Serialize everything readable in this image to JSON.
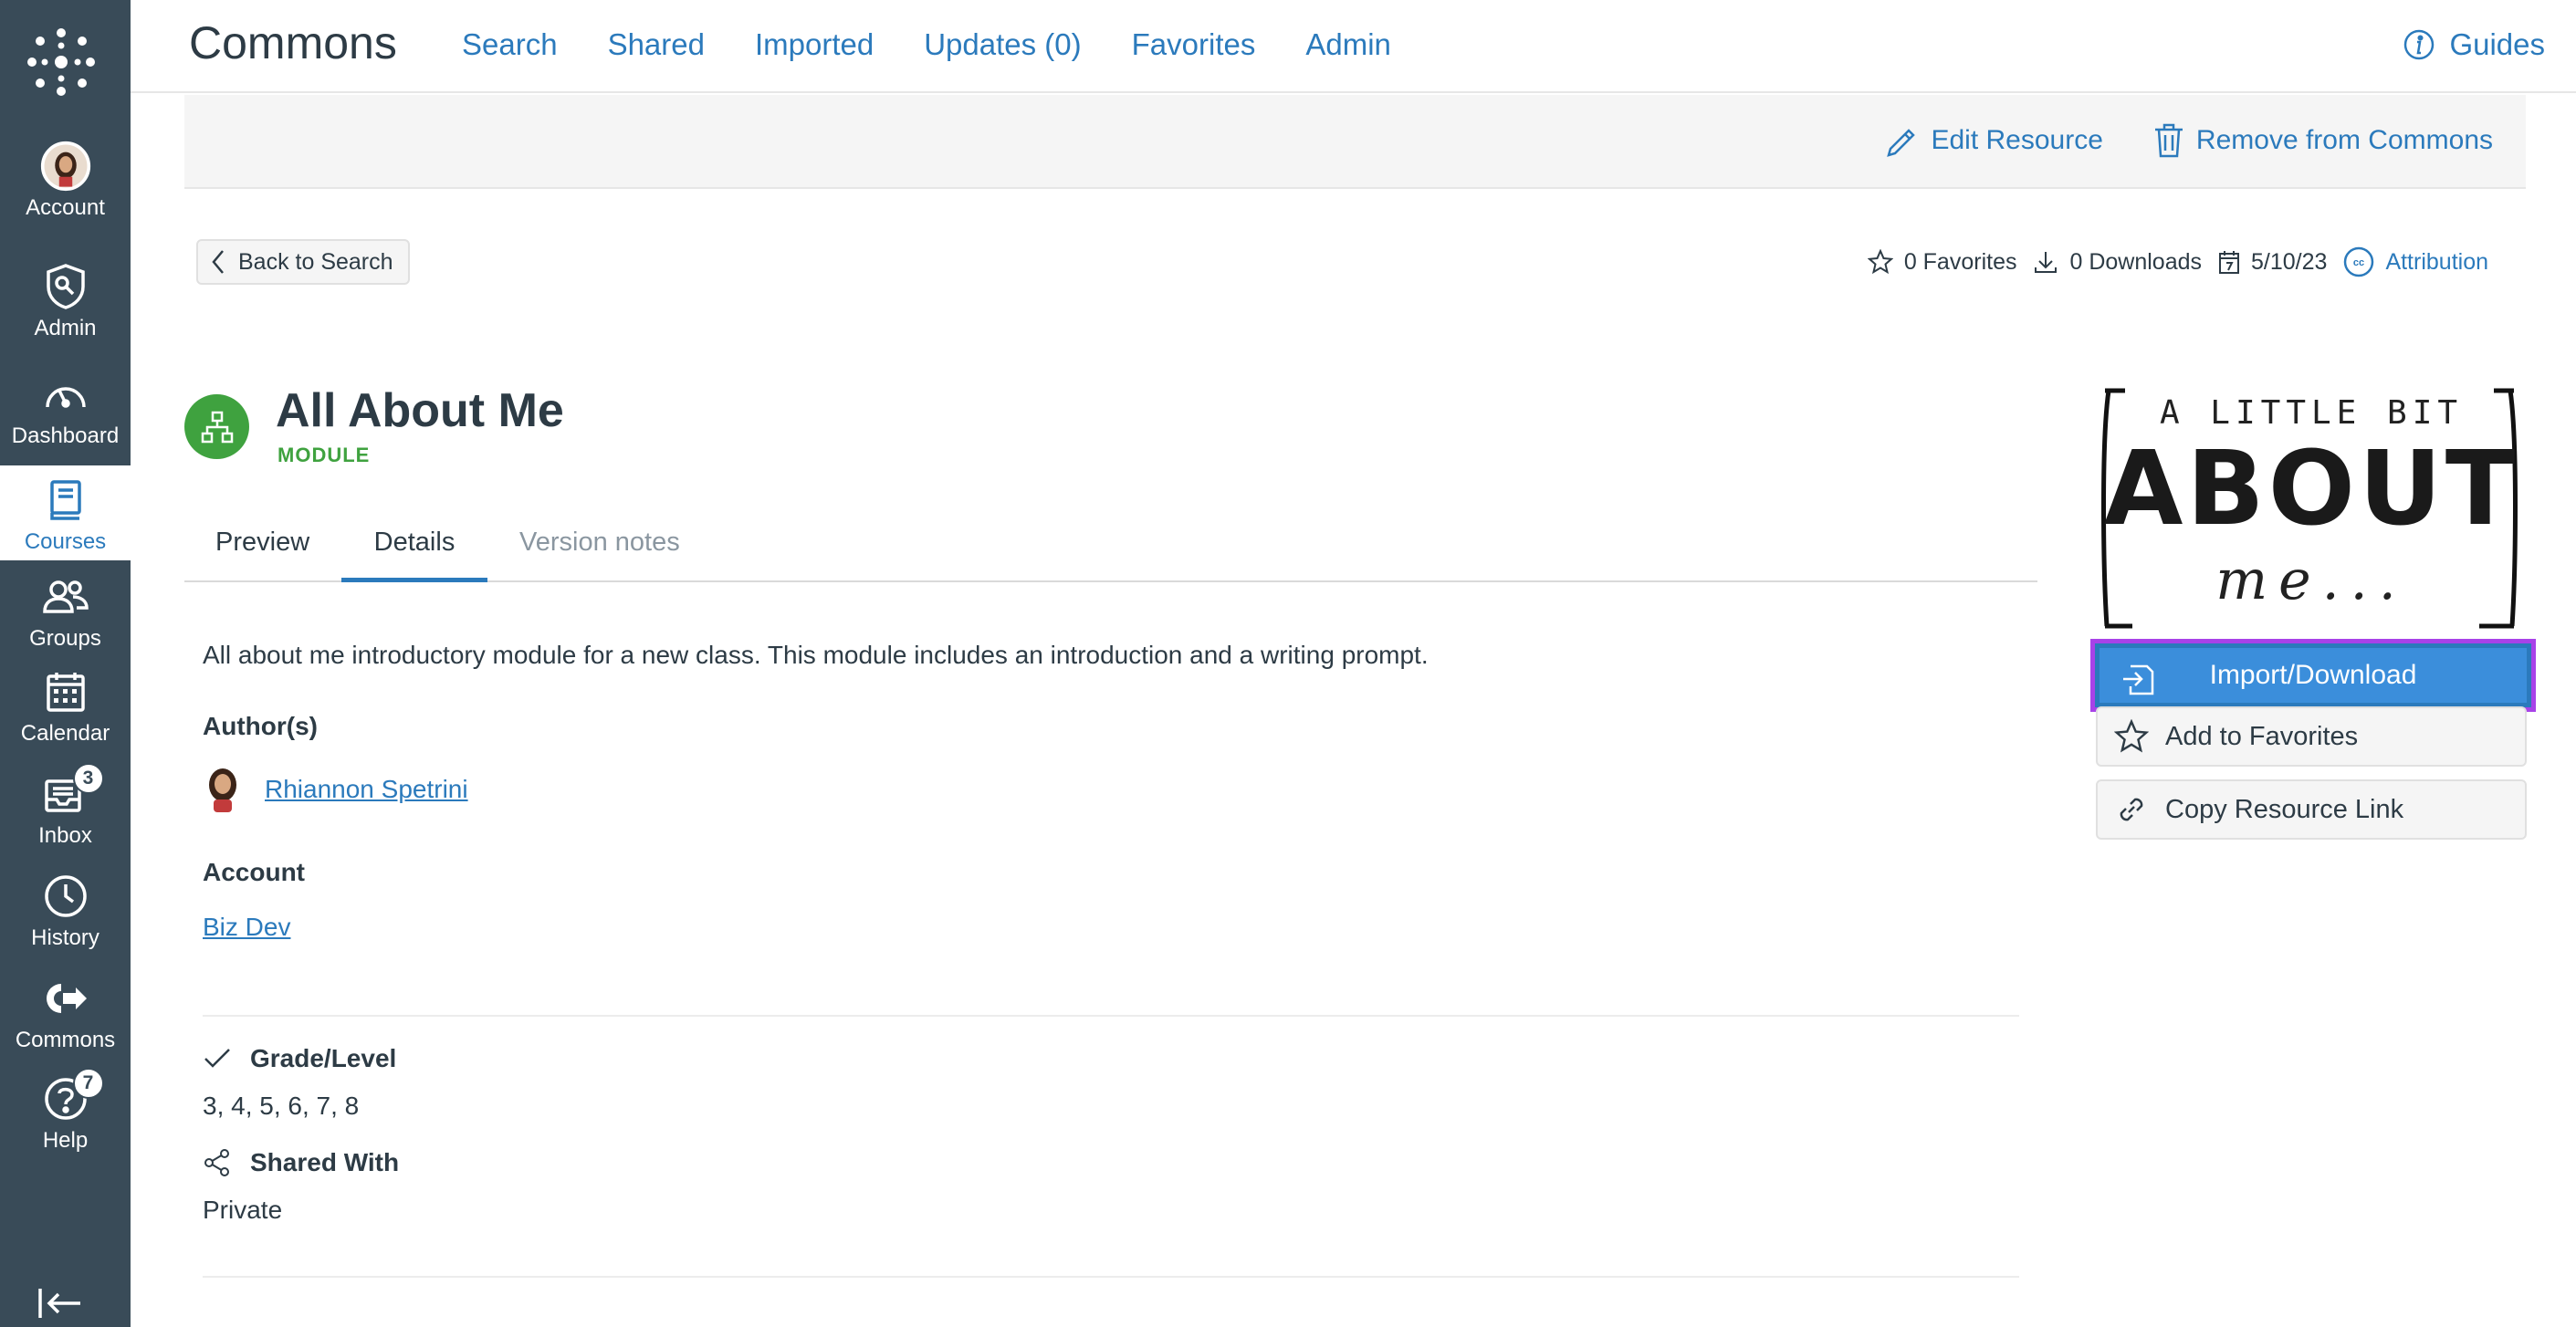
{
  "nav": {
    "items": [
      {
        "label": "Account",
        "icon": "avatar-icon"
      },
      {
        "label": "Admin",
        "icon": "shield-icon"
      },
      {
        "label": "Dashboard",
        "icon": "dashboard-icon"
      },
      {
        "label": "Courses",
        "icon": "book-icon",
        "active": true
      },
      {
        "label": "Groups",
        "icon": "users-icon"
      },
      {
        "label": "Calendar",
        "icon": "calendar-icon"
      },
      {
        "label": "Inbox",
        "icon": "inbox-icon",
        "badge": "3"
      },
      {
        "label": "History",
        "icon": "clock-icon"
      },
      {
        "label": "Commons",
        "icon": "commons-icon"
      },
      {
        "label": "Help",
        "icon": "help-icon",
        "badge": "7"
      }
    ]
  },
  "header": {
    "brand": "Commons",
    "links": [
      "Search",
      "Shared",
      "Imported",
      "Updates (0)",
      "Favorites",
      "Admin"
    ],
    "guides": "Guides"
  },
  "actions": {
    "edit": "Edit Resource",
    "remove": "Remove from Commons"
  },
  "back": "Back to Search",
  "meta": {
    "favorites": "0 Favorites",
    "downloads": "0 Downloads",
    "date": "5/10/23",
    "attribution": "Attribution"
  },
  "resource": {
    "title": "All About Me",
    "type": "MODULE"
  },
  "tabs": [
    "Preview",
    "Details",
    "Version notes"
  ],
  "details": {
    "description": "All about me introductory module for a new class. This module includes an introduction and a writing prompt.",
    "authors_heading": "Author(s)",
    "author": "Rhiannon Spetrini",
    "account_heading": "Account",
    "account": "Biz Dev",
    "grade_heading": "Grade/Level",
    "grade": "3, 4, 5, 6, 7, 8",
    "shared_heading": "Shared With",
    "shared": "Private"
  },
  "thumbnail": {
    "line1": "A LITTLE BIT",
    "line2": "ABOUT",
    "line3": "me..."
  },
  "sidebar_buttons": {
    "import": "Import/Download",
    "favorite": "Add to Favorites",
    "copy": "Copy Resource Link"
  },
  "colors": {
    "nav_bg": "#394b58",
    "link": "#2b7abc",
    "module_green": "#3fa23f",
    "focus_ring": "#a842e8"
  }
}
